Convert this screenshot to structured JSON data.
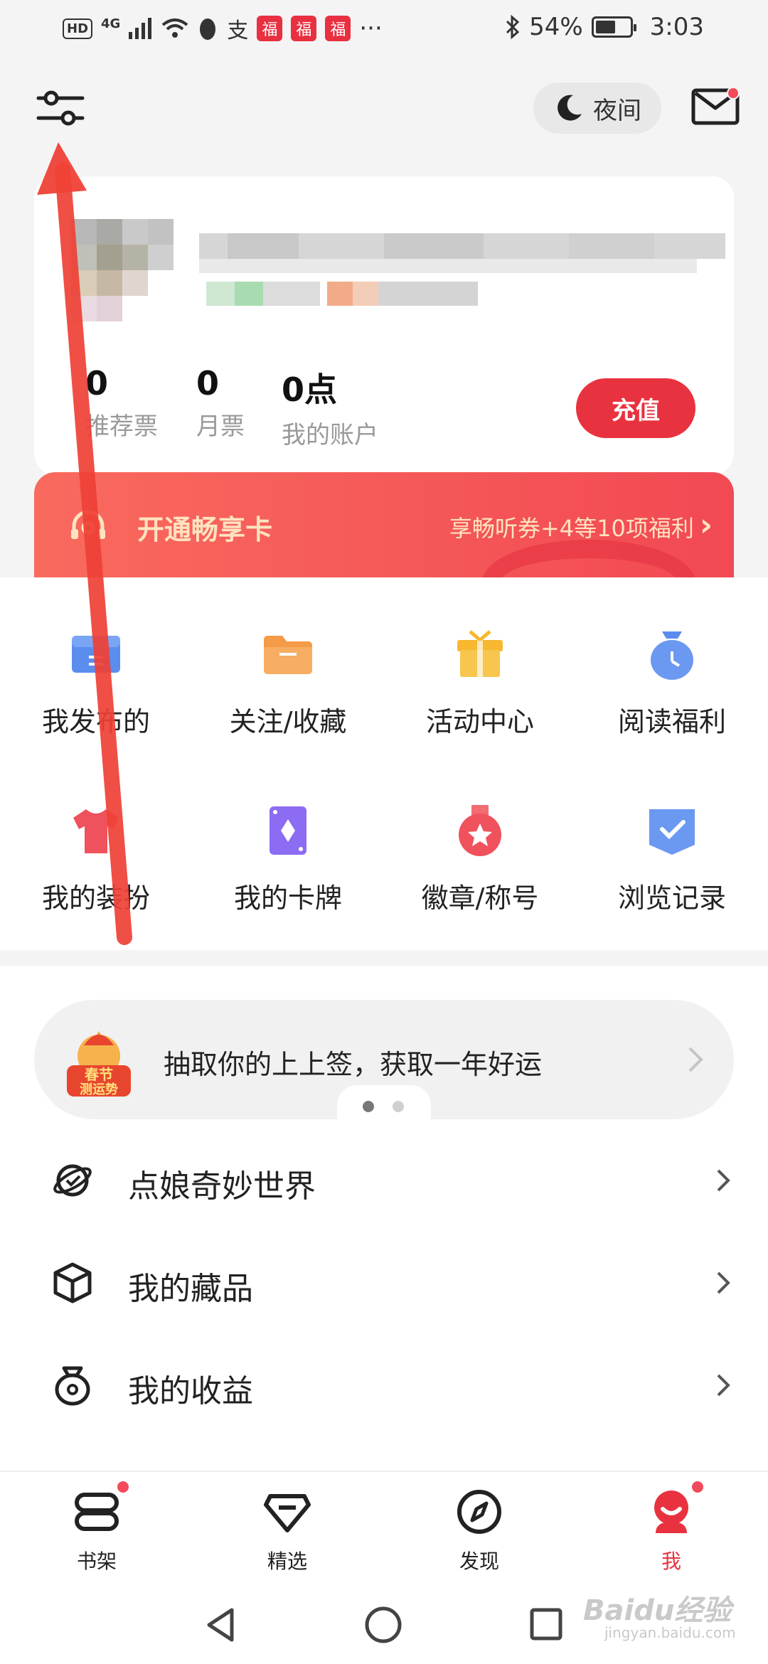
{
  "status_bar": {
    "network": "4G",
    "hd": "HD",
    "alipay": "支",
    "red_icon_glyph": "福",
    "more": "···",
    "battery": "54%",
    "time": "3:03"
  },
  "header": {
    "settings_icon": "sliders-icon",
    "night_mode_label": "夜间",
    "mail_icon": "envelope-icon"
  },
  "profile": {
    "stats": [
      {
        "value": "0",
        "label": "推荐票"
      },
      {
        "value": "0",
        "label": "月票"
      },
      {
        "value": "0点",
        "label": "我的账户"
      }
    ],
    "recharge_label": "充值"
  },
  "vip_banner": {
    "title": "开通畅享卡",
    "benefit": "享畅听券+4等10项福利",
    "arrow": "›"
  },
  "grid": [
    {
      "label": "我发布的",
      "icon": "blue-card-icon",
      "color": "#5b8def"
    },
    {
      "label": "关注/收藏",
      "icon": "folder-icon",
      "color": "#f59a46"
    },
    {
      "label": "活动中心",
      "icon": "gift-box-icon",
      "color": "#f7b72f"
    },
    {
      "label": "阅读福利",
      "icon": "money-bag-clock-icon",
      "color": "#5b8def"
    },
    {
      "label": "我的装扮",
      "icon": "tshirt-icon",
      "color": "#f0525d"
    },
    {
      "label": "我的卡牌",
      "icon": "diamond-card-icon",
      "color": "#8b6cf2"
    },
    {
      "label": "徽章/称号",
      "icon": "medal-icon",
      "color": "#f0525d"
    },
    {
      "label": "浏览记录",
      "icon": "check-shield-icon",
      "color": "#5b8def"
    }
  ],
  "lottery": {
    "badge_line1": "春节",
    "badge_line2": "测运势",
    "text": "抽取你的上上签，获取一年好运"
  },
  "menu": [
    {
      "label": "点娘奇妙世界",
      "icon": "planet-icon"
    },
    {
      "label": "我的藏品",
      "icon": "cube-icon"
    },
    {
      "label": "我的收益",
      "icon": "money-bag-icon"
    }
  ],
  "bottom_nav": [
    {
      "label": "书架",
      "icon": "bookshelf-icon",
      "active": false
    },
    {
      "label": "精选",
      "icon": "diamond-icon",
      "active": false
    },
    {
      "label": "发现",
      "icon": "compass-icon",
      "active": false
    },
    {
      "label": "我",
      "icon": "profile-mascot-icon",
      "active": true
    }
  ],
  "watermark": {
    "brand": "Baidu经验",
    "domain": "jingyan.baidu.com"
  },
  "colors": {
    "accent": "#e9323f",
    "badge": "#f24a5a",
    "banner_text": "#ffe3c0",
    "annotation_arrow": "#ef4136"
  }
}
